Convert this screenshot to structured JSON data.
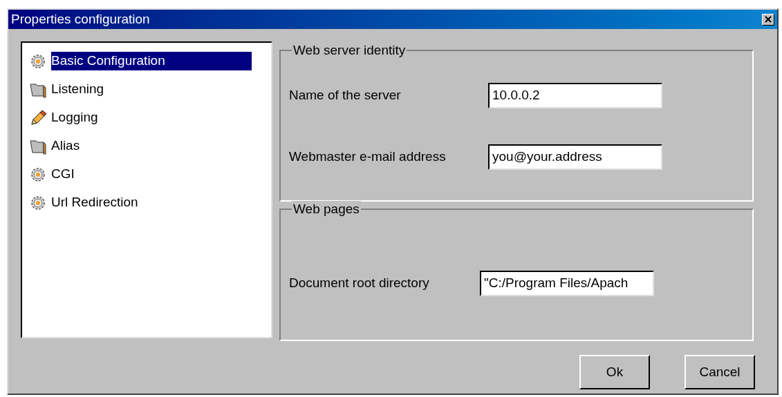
{
  "window": {
    "title": "Properties configuration"
  },
  "sidebar": {
    "items": [
      {
        "label": "Basic Configuration",
        "kind": "gear",
        "selected": true
      },
      {
        "label": "Listening",
        "kind": "folder",
        "selected": false
      },
      {
        "label": "Logging",
        "kind": "pencil",
        "selected": false
      },
      {
        "label": "Alias",
        "kind": "folder",
        "selected": false
      },
      {
        "label": "CGI",
        "kind": "gear",
        "selected": false
      },
      {
        "label": "Url Redirection",
        "kind": "gear",
        "selected": false
      }
    ]
  },
  "groups": [
    {
      "title": "Web server identity",
      "fields": [
        {
          "label": "Name of the server",
          "value": "10.0.0.2"
        },
        {
          "label": "Webmaster e-mail address",
          "value": "you@your.address"
        }
      ]
    },
    {
      "title": "Web pages",
      "fields": [
        {
          "label": "Document root directory",
          "value": "\"C:/Program Files/Apach"
        }
      ]
    }
  ],
  "buttons": [
    "Ok",
    "Cancel"
  ]
}
